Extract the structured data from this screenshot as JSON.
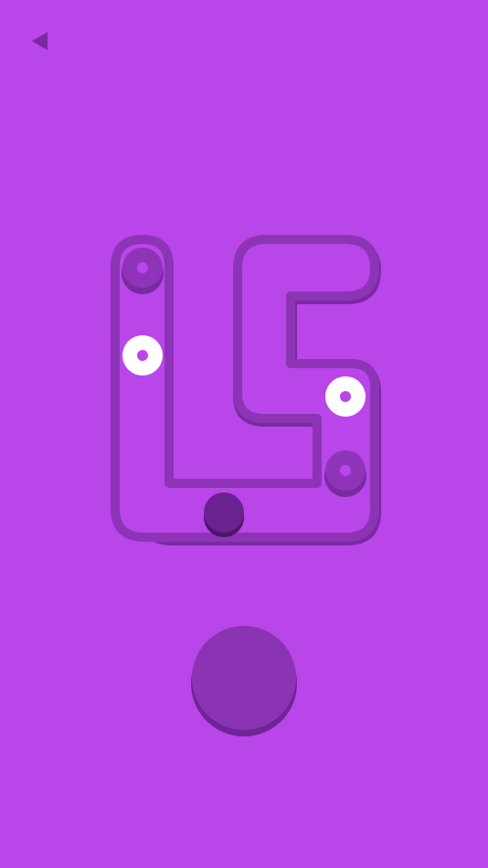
{
  "colors": {
    "background": "#b946e9",
    "track_wall": "#7a2aa1",
    "track_floor": "#b946e9",
    "socket": "#8f34b9",
    "ring": "#ffffff",
    "player": "#6a2290",
    "button": "#8a33b3",
    "button_shadow": "#6e2496"
  },
  "icons": {
    "back": "back-triangle-icon"
  },
  "game": {
    "targets_total": 4,
    "rings_placed": 2,
    "button_label": ""
  }
}
